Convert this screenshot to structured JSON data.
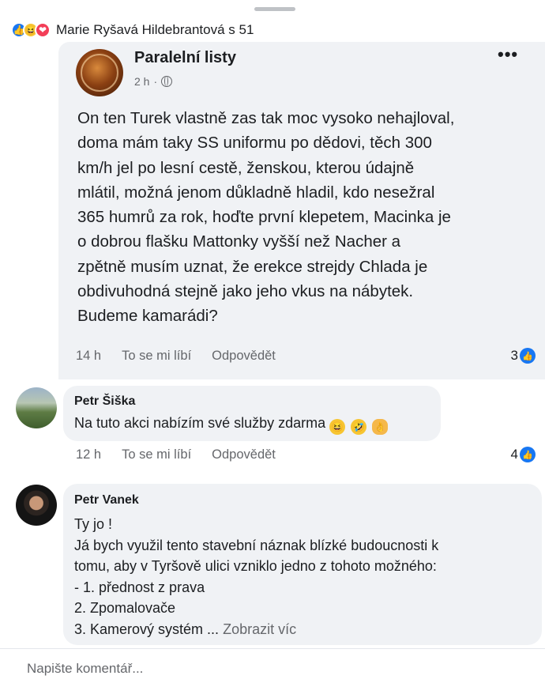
{
  "reactions": {
    "icons": [
      "like-icon",
      "haha-icon",
      "love-icon"
    ],
    "text": "Marie Ryšavá Hildebrantová s 51"
  },
  "post": {
    "page_name": "Paralelní listy",
    "time": "2 h",
    "more": "•••",
    "body_lines": [
      "On ten Turek vlastně zas tak moc vysoko nehajloval,",
      "doma mám taky SS uniformu po dědovi, těch 300",
      "km/h jel po lesní cestě, ženskou, kterou údajně",
      "mlátil, možná jenom důkladně hladil, kdo nesežral",
      "365 humrů za rok, hoďte první klepetem, Macinka je",
      "o dobrou flašku Mattonky vyšší než Nacher a",
      "zpětně musím uznat, že erekce strejdy Chlada je",
      "obdivuhodná stejně jako jeho vkus na nábytek.",
      "Budeme kamarádi?"
    ],
    "time_ago": "14 h",
    "like_label": "To se mi líbí",
    "reply_label": "Odpovědět",
    "like_count": "3"
  },
  "comments": [
    {
      "author": "Petr Šiška",
      "text": "Na tuto akci nabízím své služby zdarma",
      "time_ago": "12 h",
      "like_label": "To se mi líbí",
      "reply_label": "Odpovědět",
      "like_count": "4"
    },
    {
      "author": "Petr Vanek",
      "lines": [
        "Ty jo !",
        "Já bych využil tento stavební náznak blízké budoucnosti k",
        "tomu,  aby v Tyršově ulici vzniklo jedno z tohoto možného:",
        "- 1. přednost  z prava",
        "2. Zpomalovače",
        "3. Kamerový  systém ..."
      ],
      "see_more": "Zobrazit víc"
    }
  ],
  "composer": {
    "placeholder": "Napište komentář..."
  },
  "colors": {
    "accent": "#1877f2",
    "bubble": "#f0f2f5",
    "meta": "#65676b"
  }
}
